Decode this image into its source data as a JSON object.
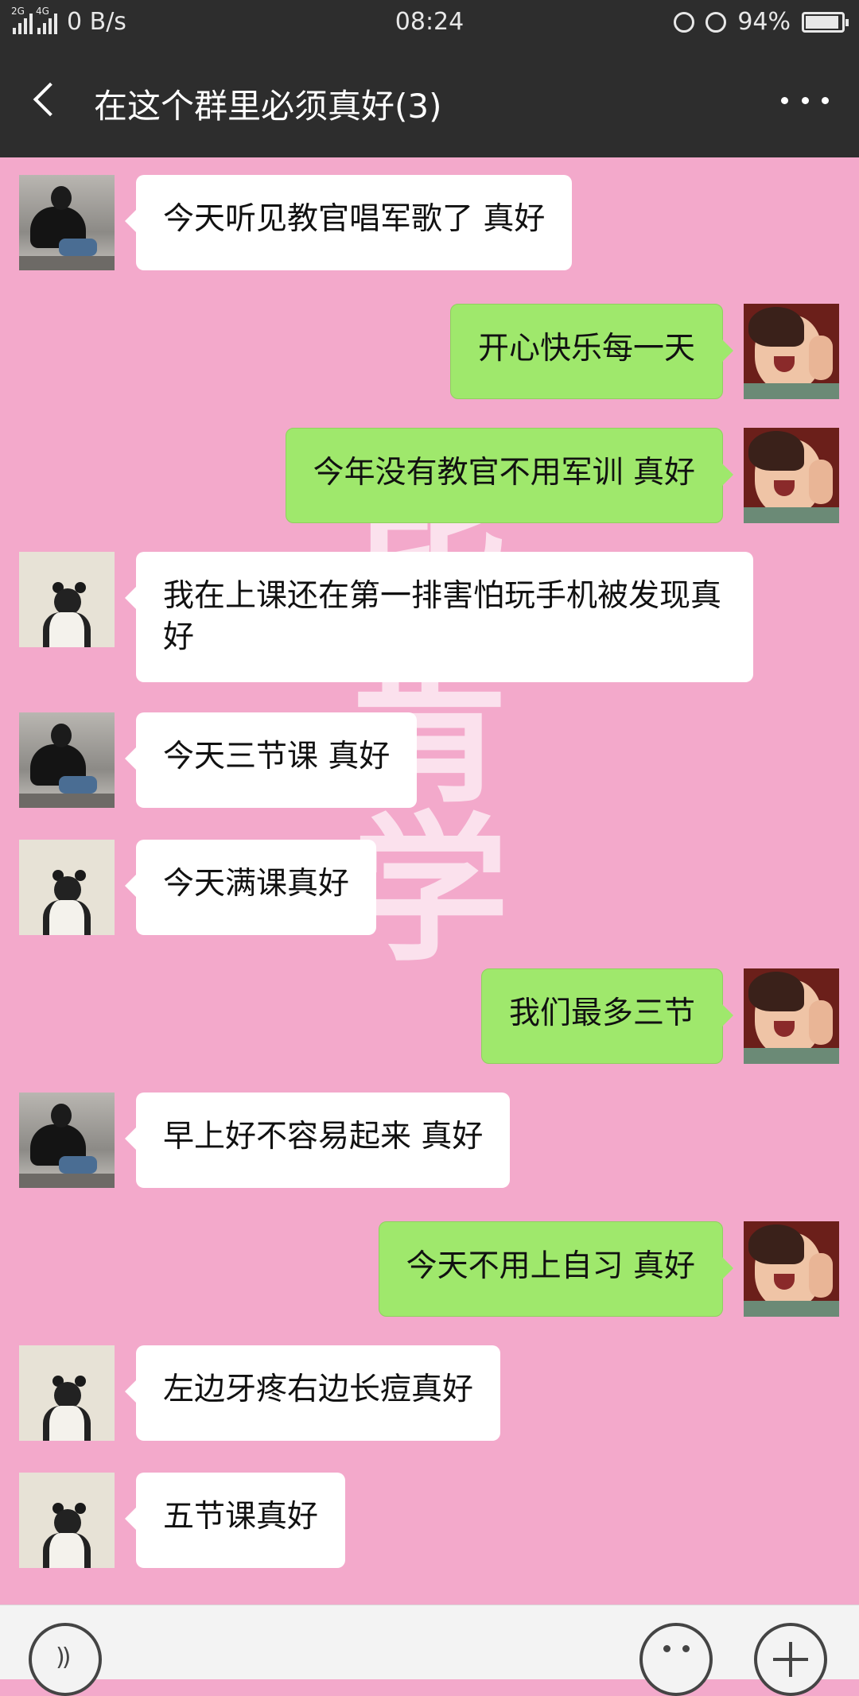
{
  "status_bar": {
    "net_labels": [
      "2G",
      "4G"
    ],
    "speed": "0 B/s",
    "time": "08:24",
    "battery": "94%",
    "battery_level": 0.94
  },
  "header": {
    "title": "在这个群里必须真好(3)"
  },
  "watermark": "毕肯学",
  "colors": {
    "chat_background": "#f3a9cb",
    "sent_bubble": "#9fe86c",
    "received_bubble": "#ffffff",
    "title_bar": "#2d2d2d"
  },
  "messages": [
    {
      "side": "left",
      "avatar": "girl-sitting-avatar",
      "text": "今天听见教官唱军歌了  真好"
    },
    {
      "side": "right",
      "avatar": "child-avatar",
      "text": "开心快乐每一天"
    },
    {
      "side": "right",
      "avatar": "child-avatar",
      "text": "今年没有教官不用军训  真好"
    },
    {
      "side": "left",
      "avatar": "bun-girl-avatar",
      "text": "我在上课还在第一排害怕玩手机被发现真好"
    },
    {
      "side": "left",
      "avatar": "girl-sitting-avatar",
      "text": "今天三节课  真好"
    },
    {
      "side": "left",
      "avatar": "bun-girl-avatar",
      "text": "今天满课真好"
    },
    {
      "side": "right",
      "avatar": "child-avatar",
      "text": "我们最多三节"
    },
    {
      "side": "left",
      "avatar": "girl-sitting-avatar",
      "text": "早上好不容易起来  真好"
    },
    {
      "side": "right",
      "avatar": "child-avatar",
      "text": "今天不用上自习  真好"
    },
    {
      "side": "left",
      "avatar": "bun-girl-avatar",
      "text": "左边牙疼右边长痘真好"
    },
    {
      "side": "left",
      "avatar": "bun-girl-avatar",
      "text": "五节课真好"
    }
  ]
}
